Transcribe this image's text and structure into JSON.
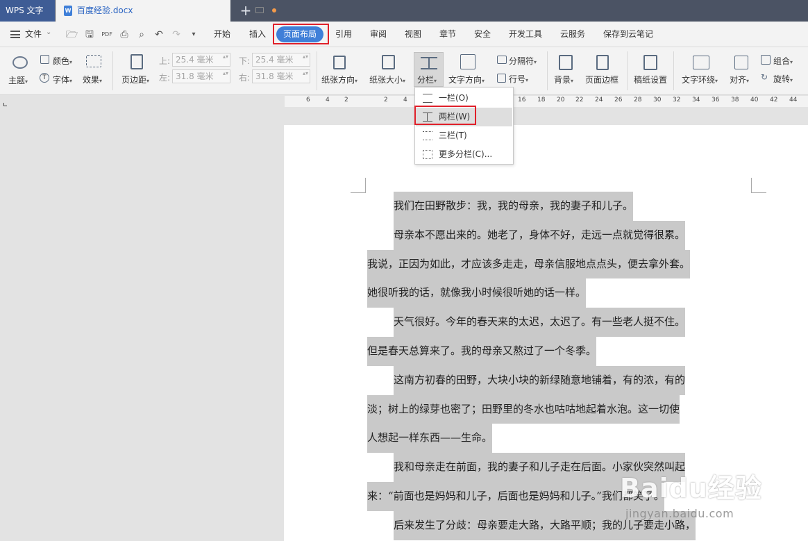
{
  "titlebar": {
    "app_name": "WPS 文字",
    "doc_tab": "百度经验.docx",
    "doc_icon_letter": "W",
    "new_tab": "+"
  },
  "menubar": {
    "file_label": "文件",
    "tabs": [
      "开始",
      "插入",
      "页面布局",
      "引用",
      "审阅",
      "视图",
      "章节",
      "安全",
      "开发工具",
      "云服务",
      "保存到云笔记"
    ],
    "active_tab": "页面布局"
  },
  "ribbon": {
    "theme": "主题",
    "color": "颜色",
    "font": "字体",
    "effect": "效果",
    "margins": "页边距",
    "top_label": "上:",
    "top_value": "25.4 毫米",
    "bottom_label": "下:",
    "bottom_value": "25.4 毫米",
    "left_label": "左:",
    "left_value": "31.8 毫米",
    "right_label": "右:",
    "right_value": "31.8 毫米",
    "orientation": "纸张方向",
    "size": "纸张大小",
    "columns": "分栏",
    "text_direction": "文字方向",
    "breaks": "分隔符",
    "line_numbers": "行号",
    "background": "背景",
    "page_border": "页面边框",
    "grid_paper": "稿纸设置",
    "wrap": "文字环绕",
    "align": "对齐",
    "group": "组合",
    "rotate": "旋转"
  },
  "ruler": {
    "numbers": [
      "6",
      "4",
      "2",
      "2",
      "4",
      "16",
      "18",
      "20",
      "22",
      "24",
      "26",
      "28",
      "30",
      "32",
      "34",
      "36",
      "38",
      "40",
      "42",
      "44"
    ]
  },
  "dropdown": {
    "items": [
      "一栏(O)",
      "两栏(W)",
      "三栏(T)",
      "更多分栏(C)..."
    ],
    "highlighted": "两栏(W)"
  },
  "document": {
    "lines": [
      "我们在田野散步：我，我的母亲，我的妻子和儿子。",
      "母亲本不愿出来的。她老了，身体不好，走远一点就觉得很累。",
      "我说，正因为如此，才应该多走走，母亲信服地点点头，便去拿外套。",
      "她很听我的话，就像我小时候很听她的话一样。",
      "天气很好。今年的春天来的太迟，太迟了。有一些老人挺不住。",
      "但是春天总算来了。我的母亲又熬过了一个冬季。",
      "这南方初春的田野，大块小块的新绿随意地铺着，有的浓，有的",
      "淡；树上的绿芽也密了；田野里的冬水也咕咕地起着水泡。这一切使",
      "人想起一样东西——生命。",
      "我和母亲走在前面，我的妻子和儿子走在后面。小家伙突然叫起",
      "来：“前面也是妈妈和儿子，后面也是妈妈和儿子。”我们都笑了。",
      "后来发生了分歧：母亲要走大路，大路平顺；我的儿子要走小路，"
    ],
    "indented": [
      0,
      1,
      4,
      6,
      9,
      11
    ]
  },
  "watermark": {
    "logo": "Baidu经验",
    "url": "jingyan.baidu.com"
  }
}
